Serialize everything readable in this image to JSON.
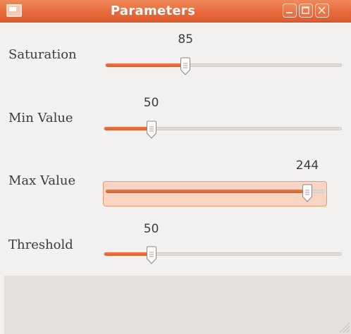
{
  "window": {
    "title": "Parameters",
    "accent": "#e8693a",
    "controls": [
      "minimize-icon",
      "maximize-icon",
      "close-icon"
    ]
  },
  "sliders": [
    {
      "label": "Saturation",
      "value": "85",
      "fraction": 0.34
    },
    {
      "label": "Min Value",
      "value": "50",
      "fraction": 0.2
    },
    {
      "label": "Max Value",
      "value": "244",
      "fraction": 0.92
    },
    {
      "label": "Threshold",
      "value": "50",
      "fraction": 0.2
    }
  ]
}
